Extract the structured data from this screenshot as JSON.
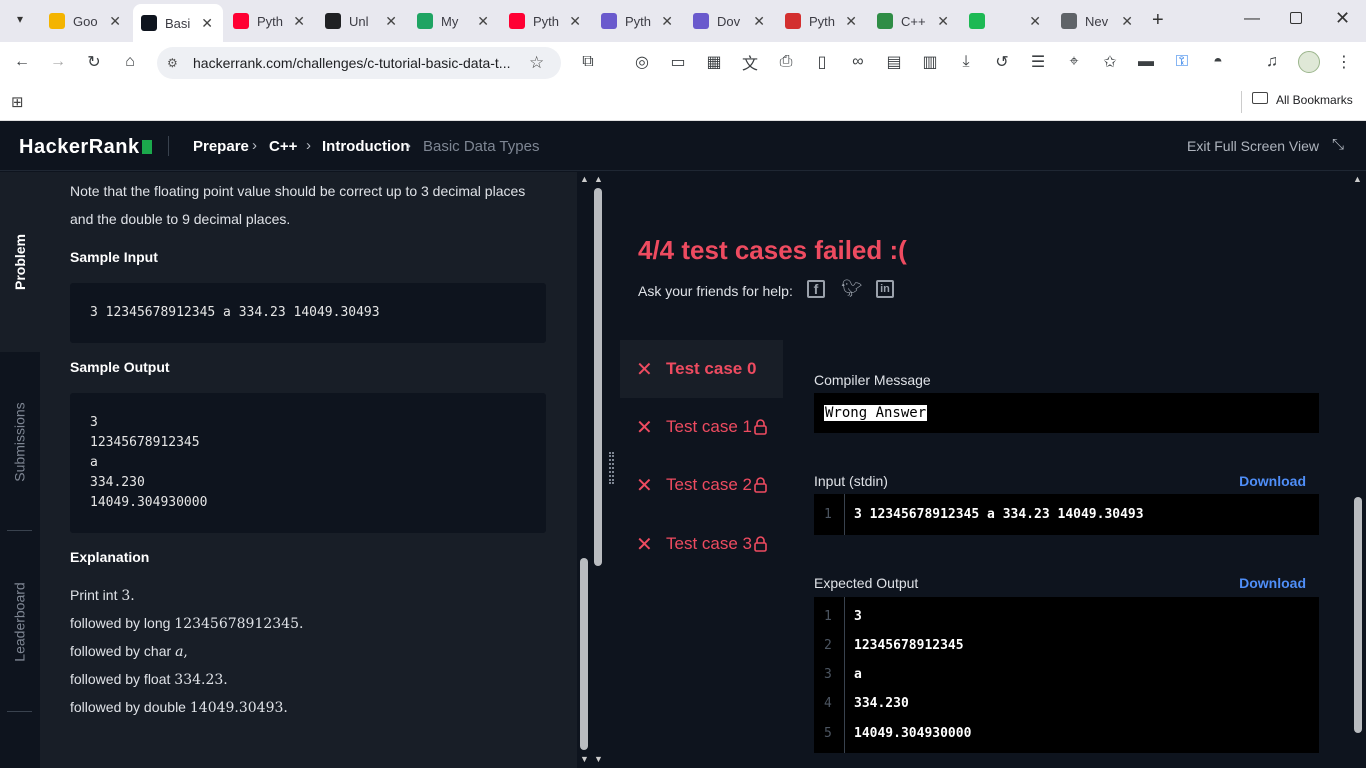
{
  "browser": {
    "tabs": [
      {
        "title": "Goo",
        "favicon": "google-docs-icon",
        "color": "#f4b400"
      },
      {
        "title": "Basi",
        "favicon": "hackerrank-icon",
        "color": "#0e141e"
      },
      {
        "title": "Pyth",
        "favicon": "youtube-icon",
        "color": "#ff0033"
      },
      {
        "title": "Unl",
        "favicon": "openai-icon",
        "color": "#202124"
      },
      {
        "title": "My",
        "favicon": "google-drive-icon",
        "color": "#1fa463"
      },
      {
        "title": "Pyth",
        "favicon": "youtube-icon",
        "color": "#ff0033"
      },
      {
        "title": "Pyth",
        "favicon": "avatar-icon",
        "color": "#6a5acd"
      },
      {
        "title": "Dov",
        "favicon": "avatar-icon",
        "color": "#6a5acd"
      },
      {
        "title": "Pyth",
        "favicon": "pdf-icon",
        "color": "#d32f2f"
      },
      {
        "title": "C++",
        "favicon": "geeksforgeeks-icon",
        "color": "#2f8d46"
      },
      {
        "title": "",
        "favicon": "spotify-icon",
        "color": "#1db954"
      },
      {
        "title": "Nev",
        "favicon": "chrome-icon",
        "color": "#5f6368"
      }
    ],
    "url": "hackerrank.com/challenges/c-tutorial-basic-data-t...",
    "all_bookmarks": "All Bookmarks"
  },
  "header": {
    "logo": "HackerRank",
    "breadcrumb": [
      "Prepare",
      "C++",
      "Introduction",
      "Basic Data Types"
    ],
    "exit_fullscreen": "Exit Full Screen View"
  },
  "rail": {
    "problem": "Problem",
    "submissions": "Submissions",
    "leaderboard": "Leaderboard"
  },
  "problem": {
    "note_line1": "Note that the floating point value should be correct up to 3 decimal places",
    "note_line2": "and the double to 9 decimal places.",
    "sample_input_title": "Sample Input",
    "sample_input": "3 12345678912345 a 334.23 14049.30493",
    "sample_output_title": "Sample Output",
    "sample_output": [
      "3",
      "12345678912345",
      "a",
      "334.230",
      "14049.304930000"
    ],
    "explanation_title": "Explanation",
    "explanation": [
      {
        "text": "Print int ",
        "val": "3",
        "end": "."
      },
      {
        "text": "followed by long ",
        "val": "12345678912345",
        "end": "."
      },
      {
        "text": "followed by char ",
        "val": "a",
        "end": ","
      },
      {
        "text": "followed by float ",
        "val": "334.23",
        "end": "."
      },
      {
        "text": "followed by double ",
        "val": "14049.30493",
        "end": "."
      }
    ]
  },
  "result": {
    "title": "4/4 test cases failed :(",
    "share_label": "Ask your friends for help:",
    "test_cases": [
      "Test case 0",
      "Test case 1",
      "Test case 2",
      "Test case 3"
    ],
    "compiler_label": "Compiler Message",
    "compiler_message": "Wrong Answer",
    "input_label": "Input (stdin)",
    "download": "Download",
    "input_lines": [
      "3 12345678912345 a 334.23 14049.30493"
    ],
    "expected_label": "Expected Output",
    "expected_lines": [
      "3",
      "12345678912345",
      "a",
      "334.230",
      "14049.304930000"
    ]
  },
  "colors": {
    "fail": "#ee4b60",
    "accent": "#1ba94c",
    "link": "#4f8ef7"
  }
}
